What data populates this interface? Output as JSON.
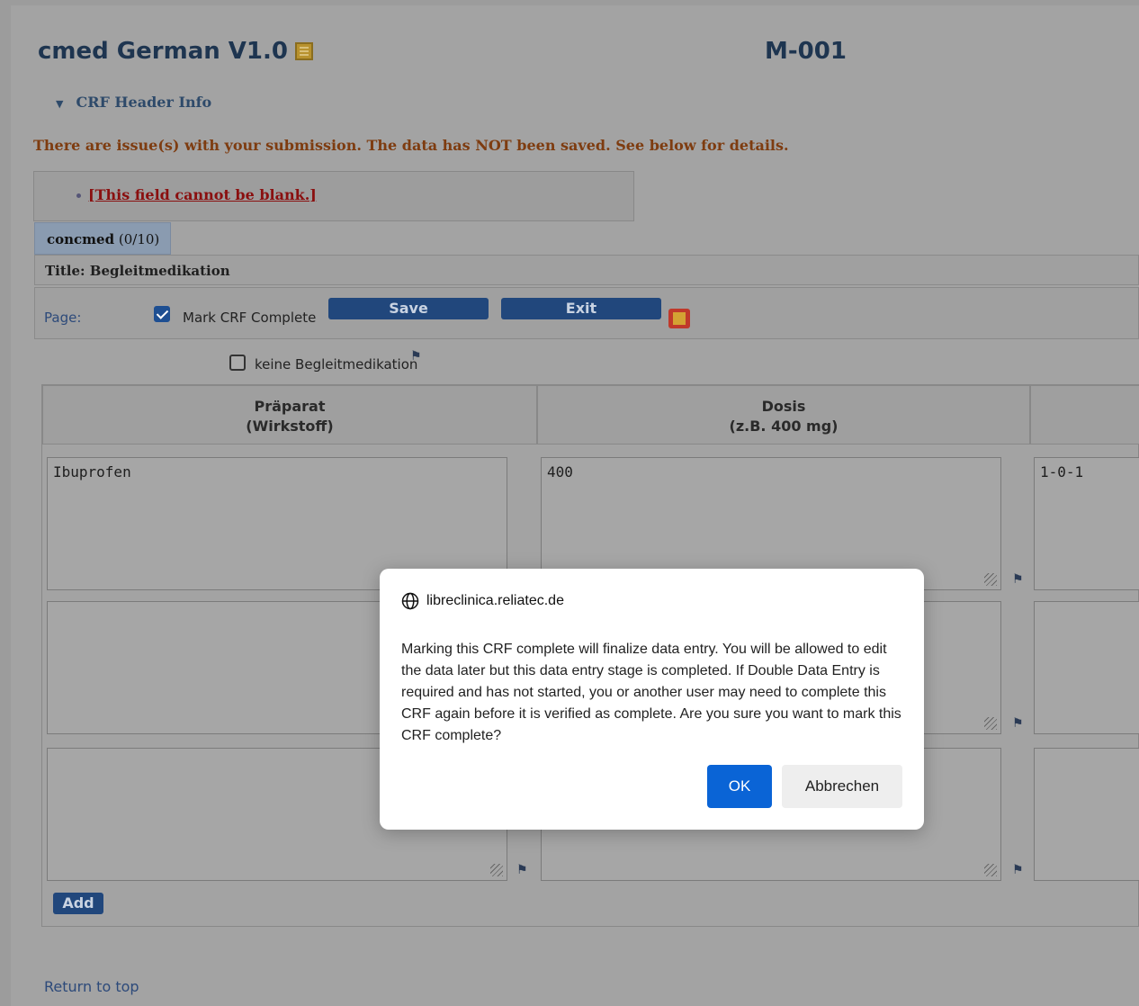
{
  "header": {
    "crf_title": "cmed German V1.0",
    "subject_id": "M-001",
    "crf_header_toggle": "CRF Header Info"
  },
  "messages": {
    "warning": "There are issue(s) with your submission. The data has NOT been saved. See below for details.",
    "error_item": "[This field cannot be blank.]"
  },
  "tab": {
    "name": "concmed",
    "count": "(0/10)"
  },
  "section_title": "Title: Begleitmedikation",
  "toolbar": {
    "page_label": "Page:",
    "mark_complete_label": "Mark CRF Complete",
    "mark_complete_checked": true,
    "save_label": "Save",
    "exit_label": "Exit"
  },
  "no_concmed": {
    "label": "keine Begleitmedikation",
    "checked": false
  },
  "table": {
    "columns": [
      {
        "line1": "Präparat",
        "line2": "(Wirkstoff)"
      },
      {
        "line1": "Dosis",
        "line2": "(z.B. 400 mg)"
      }
    ],
    "rows": [
      {
        "praeparat": "Ibuprofen",
        "dosis": "400",
        "schema": "1-0-1"
      },
      {
        "praeparat": "",
        "dosis": "",
        "schema": ""
      },
      {
        "praeparat": "",
        "dosis": "",
        "schema": ""
      }
    ],
    "add_label": "Add"
  },
  "footer": {
    "return_to_top": "Return to top"
  },
  "dialog": {
    "site": "libreclinica.reliatec.de",
    "message": "Marking this CRF complete will finalize data entry. You will be allowed to edit the data later but this data entry stage is completed. If Double Data Entry is required and has not started, you or another user may need to complete this CRF again before it is verified as complete. Are you sure you want to mark this CRF complete?",
    "ok_label": "OK",
    "cancel_label": "Abbrechen"
  },
  "icons": {
    "crf": "crf-notes-icon",
    "exit": "exit-crf-icon",
    "flag": "flag-icon",
    "globe": "globe-icon"
  },
  "colors": {
    "primary_button": "#21477c",
    "dialog_ok": "#0a64d6",
    "error_text": "#8a0f0f",
    "warning_text": "#7e3c10"
  }
}
